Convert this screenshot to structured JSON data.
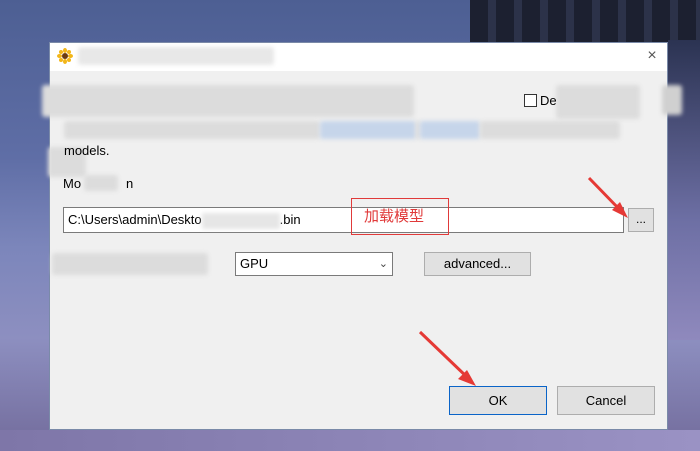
{
  "dialog": {
    "title": "",
    "close_glyph": "×",
    "checkbox": {
      "label": "De",
      "checked": false
    },
    "models_label": "models.",
    "model_label": "Mo",
    "model_label_tail": "n",
    "model_path": "C:\\Users\\admin\\Deskto",
    "model_path_tail": ".bin",
    "browse_label": "...",
    "device": {
      "selected": "GPU"
    },
    "advanced_label": "advanced...",
    "ok_label": "OK",
    "cancel_label": "Cancel"
  },
  "annotation": {
    "text": "加载模型",
    "color": "#e03a3a"
  },
  "icons": {
    "app": "sunflower-icon",
    "close": "close-icon",
    "dropdown": "chevron-down-icon"
  }
}
